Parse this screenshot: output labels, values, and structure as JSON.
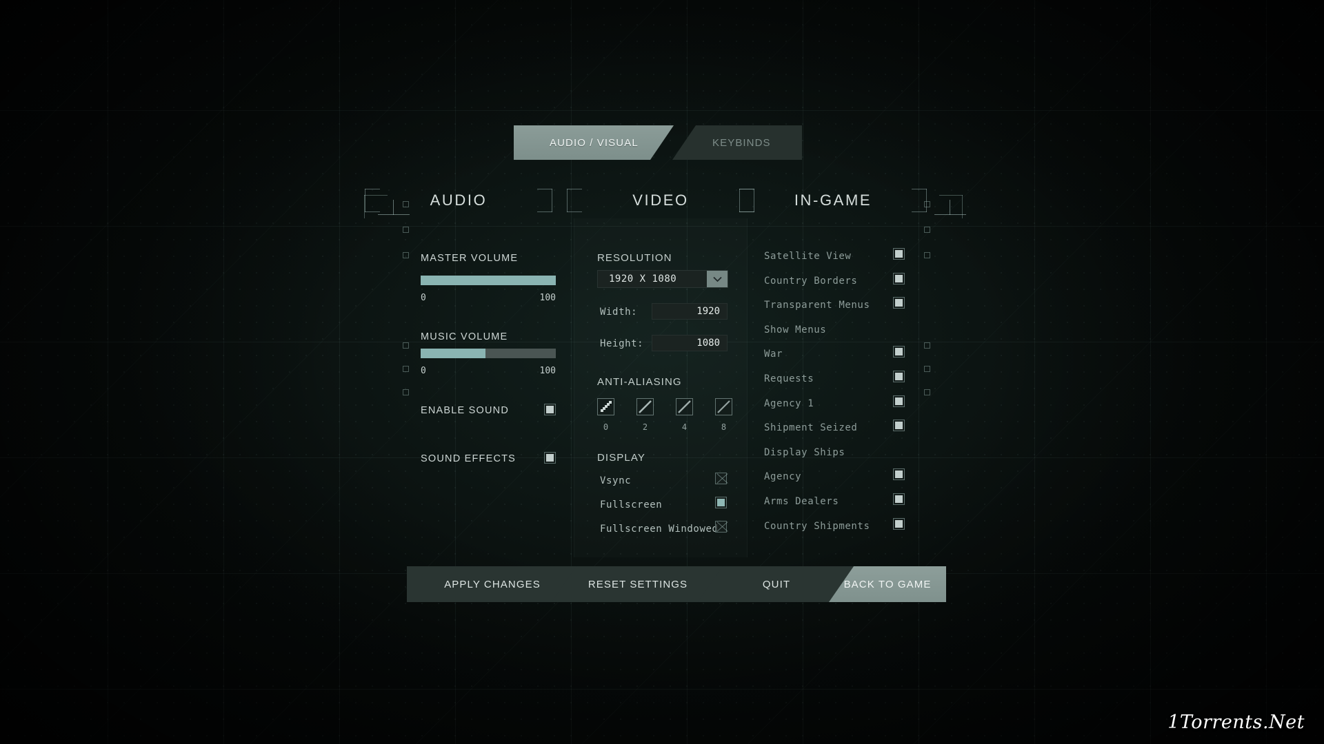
{
  "tabs": [
    {
      "label": "AUDIO / VISUAL",
      "active": true
    },
    {
      "label": "KEYBINDS",
      "active": false
    }
  ],
  "sections": {
    "audio": {
      "title": "AUDIO"
    },
    "video": {
      "title": "VIDEO"
    },
    "ingame": {
      "title": "IN-GAME"
    }
  },
  "audio": {
    "master": {
      "label": "MASTER VOLUME",
      "min": "0",
      "max": "100",
      "value": 100
    },
    "music": {
      "label": "MUSIC VOLUME",
      "min": "0",
      "max": "100",
      "value": 48
    },
    "enable_sound": {
      "label": "ENABLE SOUND",
      "checked": true
    },
    "sound_effects": {
      "label": "SOUND EFFECTS",
      "checked": true
    }
  },
  "video": {
    "resolution_title": "RESOLUTION",
    "resolution_value": "1920 X 1080",
    "width_label": "Width:",
    "width_value": "1920",
    "height_label": "Height:",
    "height_value": "1080",
    "aa_title": "ANTI-ALIASING",
    "aa_options": [
      "0",
      "2",
      "4",
      "8"
    ],
    "aa_selected": "0",
    "display_title": "DISPLAY",
    "display_options": [
      {
        "label": "Vsync",
        "state": "disabled"
      },
      {
        "label": "Fullscreen",
        "state": "checked"
      },
      {
        "label": "Fullscreen Windowed",
        "state": "disabled"
      }
    ]
  },
  "ingame": {
    "items": [
      {
        "label": "Satellite View",
        "checkbox": true,
        "checked": true
      },
      {
        "label": "Country Borders",
        "checkbox": true,
        "checked": true
      },
      {
        "label": "Transparent Menus",
        "checkbox": true,
        "checked": true
      },
      {
        "label": "Show Menus",
        "checkbox": false,
        "checked": false
      },
      {
        "label": "War",
        "checkbox": true,
        "checked": true
      },
      {
        "label": "Requests",
        "checkbox": true,
        "checked": true
      },
      {
        "label": "Agency 1",
        "checkbox": true,
        "checked": true
      },
      {
        "label": "Shipment Seized",
        "checkbox": true,
        "checked": true
      },
      {
        "label": "Display Ships",
        "checkbox": false,
        "checked": false
      },
      {
        "label": "Agency",
        "checkbox": true,
        "checked": true
      },
      {
        "label": "Arms Dealers",
        "checkbox": true,
        "checked": true
      },
      {
        "label": "Country Shipments",
        "checkbox": true,
        "checked": true
      }
    ]
  },
  "buttons": [
    {
      "label": "APPLY CHANGES",
      "highlight": false
    },
    {
      "label": "RESET SETTINGS",
      "highlight": false
    },
    {
      "label": "QUIT",
      "highlight": false
    },
    {
      "label": "BACK TO GAME",
      "highlight": true
    }
  ],
  "watermark": {
    "text": "1Torrents.Net"
  },
  "colors": {
    "accent_teal": "#8ab4b2",
    "tab_active": "#8b9c98",
    "panel_dark": "#1b2321",
    "text_primary": "#cfd8d6"
  }
}
